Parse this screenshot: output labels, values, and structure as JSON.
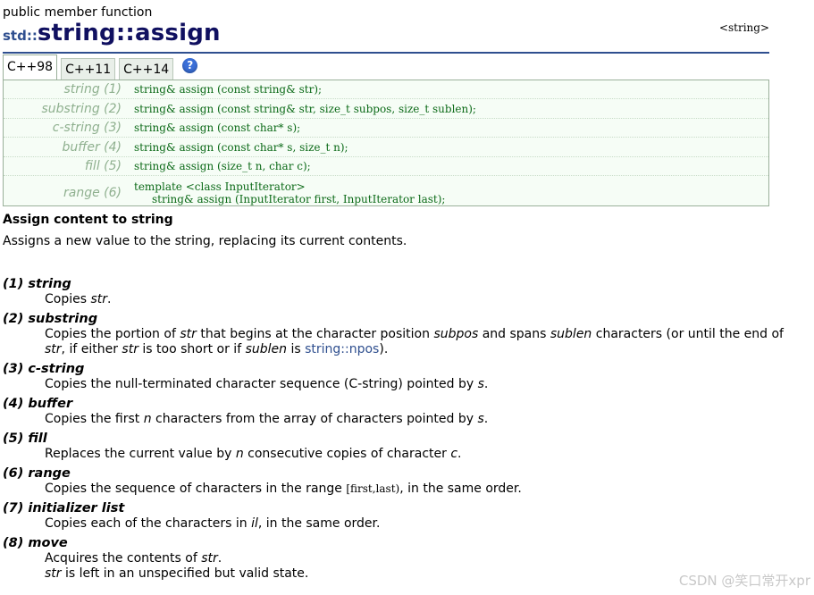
{
  "header": {
    "category": "public member function",
    "namespace": "std",
    "scope_sep": "::",
    "func_prefix": "string",
    "func_sep": "::",
    "func_name": "assign",
    "header_tag": "<string>"
  },
  "tabs": [
    {
      "label": "C++98",
      "active": true
    },
    {
      "label": "C++11",
      "active": false
    },
    {
      "label": "C++14",
      "active": false
    }
  ],
  "help_icon_glyph": "?",
  "prototypes": [
    {
      "label": "string (1)",
      "code": "string& assign (const string& str);"
    },
    {
      "label": "substring (2)",
      "code": "string& assign (const string& str, size_t subpos, size_t sublen);"
    },
    {
      "label": "c-string (3)",
      "code": "string& assign (const char* s);"
    },
    {
      "label": "buffer (4)",
      "code": "string& assign (const char* s, size_t n);"
    },
    {
      "label": "fill (5)",
      "code": "string& assign (size_t n, char c);"
    },
    {
      "label": "range (6)",
      "code_line1": "template <class InputIterator>",
      "code_line2": "string& assign (InputIterator first, InputIterator last);"
    }
  ],
  "section_title": "Assign content to string",
  "description": "Assigns a new value to the string, replacing its current contents.",
  "params": [
    {
      "head": "(1) string",
      "body_pre": "Copies ",
      "body_em": "str",
      "body_post": "."
    },
    {
      "head": "(2) substring",
      "p1": "Copies the portion of ",
      "e1": "str",
      "p2": " that begins at the character position ",
      "e2": "subpos",
      "p3": " and spans ",
      "e3": "sublen",
      "p4": " characters (or until the end of ",
      "e4": "str",
      "p5": ", if either ",
      "e5": "str",
      "p6": " is too short or if ",
      "e6": "sublen",
      "p7": " is ",
      "link": "string::npos",
      "p8": ")."
    },
    {
      "head": "(3) c-string",
      "body_pre": "Copies the null-terminated character sequence (C-string) pointed by ",
      "body_em": "s",
      "body_post": "."
    },
    {
      "head": "(4) buffer",
      "p1": "Copies the first ",
      "e1": "n",
      "p2": " characters from the array of characters pointed by ",
      "e2": "s",
      "p3": "."
    },
    {
      "head": "(5) fill",
      "p1": "Replaces the current value by ",
      "e1": "n",
      "p2": " consecutive copies of character ",
      "e2": "c",
      "p3": "."
    },
    {
      "head": "(6) range",
      "p1": "Copies the sequence of characters in the range ",
      "code": "[first,last)",
      "p2": ", in the same order."
    },
    {
      "head": "(7) initializer list",
      "p1": "Copies each of the characters in ",
      "e1": "il",
      "p2": ", in the same order."
    },
    {
      "head": "(8) move",
      "p1": "Acquires the contents of ",
      "e1": "str",
      "p2": ".",
      "line2_em": "str",
      "line2_post": " is left in an unspecified but valid state."
    }
  ],
  "watermark": "CSDN @笑口常开xpr"
}
